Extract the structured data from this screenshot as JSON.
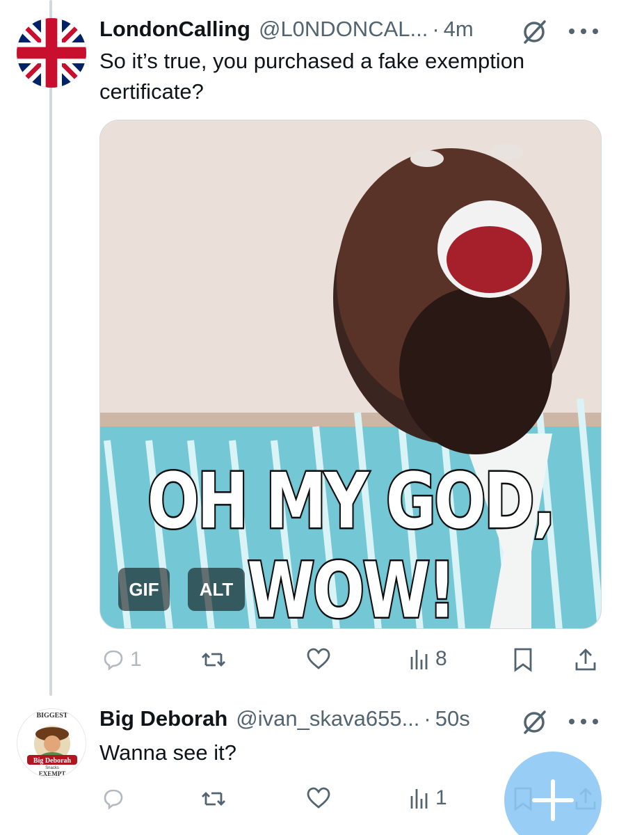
{
  "tweets": [
    {
      "name": "LondonCalling",
      "handle": "@L0NDONCAL...",
      "separator": "·",
      "time": "4m",
      "text": "So it’s true, you purchased a fake exemption certificate?",
      "media": {
        "caption": "OH MY GOD, WOW!",
        "gif_badge": "GIF",
        "alt_badge": "ALT"
      },
      "actions": {
        "reply_count": "1",
        "repost_count": "",
        "like_count": "",
        "views_count": "8"
      }
    },
    {
      "name": "Big Deborah",
      "handle": "@ivan_skava655...",
      "separator": "·",
      "time": "50s",
      "text": "Wanna see it?",
      "avatar_text": {
        "top": "BIGGEST",
        "brand": "Big Deborah",
        "small": "Snacks",
        "bottom": "EXEMPT"
      },
      "actions": {
        "reply_count": "",
        "repost_count": "",
        "like_count": "",
        "views_count": "1"
      }
    }
  ],
  "icons": {
    "reply": "reply-icon",
    "repost": "repost-icon",
    "like": "like-icon",
    "views": "views-icon",
    "bookmark": "bookmark-icon",
    "share": "share-icon",
    "grok": "grok-icon",
    "more": "more-icon",
    "compose": "compose-icon"
  },
  "colors": {
    "text": "#0f1419",
    "secondary": "#536471",
    "fab": "#8dc8f5",
    "thread_line": "#cfd9de"
  }
}
